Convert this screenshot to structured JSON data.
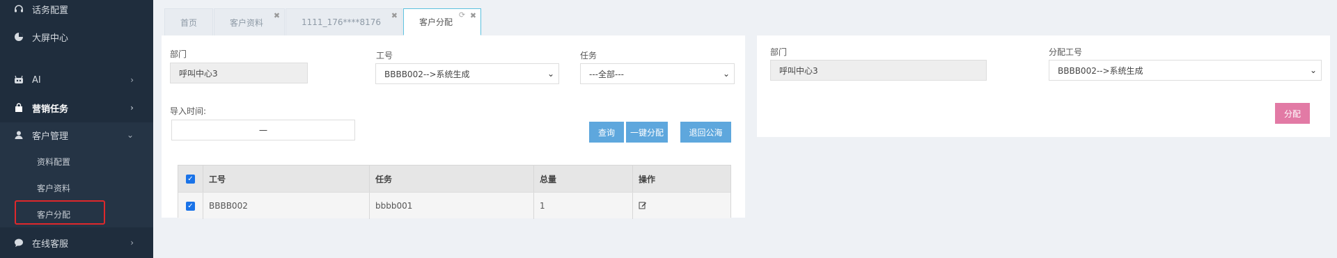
{
  "sidebar": {
    "items": [
      {
        "label": "话务配置",
        "icon": "headset-icon"
      },
      {
        "label": "大屏中心",
        "icon": "pie-chart-icon"
      },
      {
        "label": "AI",
        "icon": "robot-icon"
      },
      {
        "label": "营销任务",
        "icon": "shopping-bag-icon"
      },
      {
        "label": "客户管理",
        "icon": "user-icon"
      },
      {
        "label": "在线客服",
        "icon": "chat-icon"
      }
    ],
    "sub_items": [
      "资料配置",
      "客户资料",
      "客户分配"
    ]
  },
  "tabs": [
    {
      "label": "首页"
    },
    {
      "label": "客户资料"
    },
    {
      "label": "1111_176****8176"
    },
    {
      "label": "客户分配"
    }
  ],
  "left_panel": {
    "dept_label": "部门",
    "dept_value": "呼叫中心3",
    "worker_label": "工号",
    "worker_value": "BBBB002-->系统生成",
    "task_label": "任务",
    "task_value": "---全部---",
    "import_time_label": "导入时间:",
    "import_time_sep": "一",
    "query_button": "查询",
    "assign_all_button": "一键分配",
    "return_button": "退回公海"
  },
  "table": {
    "columns": [
      "工号",
      "任务",
      "总量",
      "操作"
    ],
    "rows": [
      {
        "worker": "BBBB002",
        "task": "bbbb001",
        "total": "1"
      }
    ]
  },
  "right_panel": {
    "dept_label": "部门",
    "dept_value": "呼叫中心3",
    "assign_worker_label": "分配工号",
    "assign_worker_value": "BBBB002-->系统生成",
    "assign_button": "分配"
  },
  "colors": {
    "sidebar_bg": "#1f2d3d",
    "primary_button": "#5ea7dd",
    "assign_button": "#e27aa5",
    "highlight_border": "#e0282b"
  }
}
